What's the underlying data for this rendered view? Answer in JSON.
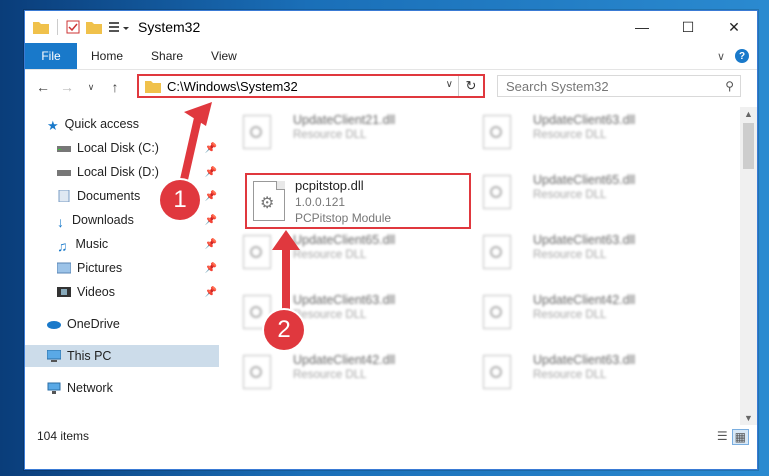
{
  "window": {
    "title": "System32"
  },
  "ribbon": {
    "file": "File",
    "tabs": [
      "Home",
      "Share",
      "View"
    ]
  },
  "nav": {
    "path": "C:\\Windows\\System32",
    "search_placeholder": "Search System32"
  },
  "sidebar": {
    "quick_access": "Quick access",
    "items": [
      "Local Disk (C:)",
      "Local Disk (D:)",
      "Documents",
      "Downloads",
      "Music",
      "Pictures",
      "Videos"
    ],
    "onedrive": "OneDrive",
    "thispc": "This PC",
    "network": "Network"
  },
  "files": [
    {
      "name": "UpdateClient21.dll",
      "type": "Resource DLL"
    },
    {
      "name": "UpdateClient63.dll",
      "type": "Resource DLL"
    },
    {
      "name": "UpdateClient65.dll",
      "type": "Resource DLL"
    },
    {
      "name": "UpdateClient65.dll",
      "type": "Resource DLL"
    },
    {
      "name": "UpdateClient63.dll",
      "type": "Resource DLL"
    },
    {
      "name": "UpdateClient63.dll",
      "type": "Resource DLL"
    },
    {
      "name": "UpdateClient42.dll",
      "type": "Resource DLL"
    },
    {
      "name": "UpdateClient42.dll",
      "type": "Resource DLL"
    },
    {
      "name": "UpdateClient63.dll",
      "type": "Resource DLL"
    }
  ],
  "focus_file": {
    "name": "pcpitstop.dll",
    "version": "1.0.0.121",
    "description": "PCPitstop Module"
  },
  "status": {
    "count": "104 items"
  },
  "annotations": {
    "step1": "1",
    "step2": "2"
  },
  "colors": {
    "accent": "#1979ca",
    "highlight": "#e0383e"
  }
}
